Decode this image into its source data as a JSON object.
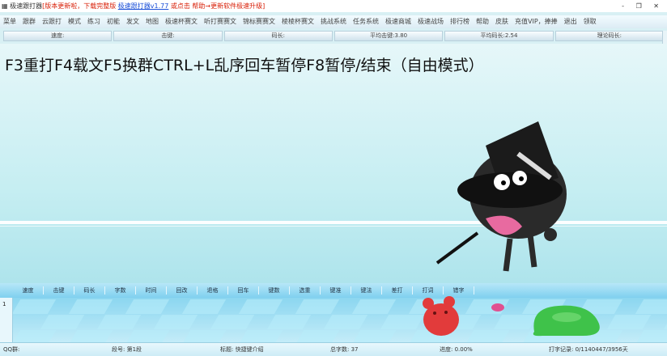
{
  "window": {
    "title": "极速跟打器",
    "notice_red": "[版本更新啦，下载完整版",
    "version_link": "极速跟打器v1.77",
    "notice_rest": "或点击 帮助→更新软件极速升级]",
    "controls": "- ❐ ✕"
  },
  "menu": [
    "菜单",
    "跟群",
    "云跟打",
    "模式",
    "练习",
    "初能",
    "发文",
    "地图",
    "极速杯赛文",
    "听打赛赛文",
    "锦标赛赛文",
    "棱棱杯赛文",
    "挑战系统",
    "任务系统",
    "极速商城",
    "极速战场",
    "排行榜",
    "帮助",
    "皮肤",
    "充值VIP，捧捧",
    "退出",
    "领取"
  ],
  "stats": [
    "速度:",
    "击键:",
    "码长:",
    "平均击键:3.80",
    "平均码长:2.54",
    "理论码长:"
  ],
  "instruction": "F3重打F4载文F5换群CTRL+L乱序回车暂停F8暂停/结束（自由模式）",
  "table": {
    "columns": [
      "速度",
      "击键",
      "码长",
      "字数",
      "时间",
      "回改",
      "退格",
      "回车",
      "键数",
      "选重",
      "键准",
      "键法",
      "差打",
      "打词",
      "错字"
    ],
    "rows": [
      {
        "index": "1"
      }
    ]
  },
  "status": {
    "qq_group": "QQ群:",
    "section": "段号: 第1段",
    "tip": "标题: 快捷键介绍",
    "total_words": "总字数: 37",
    "progress": "进度: 0.00%",
    "record": "打字记录: 0/1140447/3956天"
  },
  "colors": {
    "accent_red": "#d81e06",
    "link_blue": "#1a4fd8",
    "header_blue": "#7fd0ef"
  }
}
